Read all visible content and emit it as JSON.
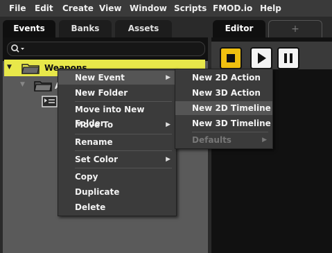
{
  "menubar": {
    "items": [
      "File",
      "Edit",
      "Create",
      "View",
      "Window",
      "Scripts",
      "FMOD.io",
      "Help"
    ]
  },
  "left_tabs": [
    "Events",
    "Banks",
    "Assets"
  ],
  "editor_tabs": {
    "editor": "Editor",
    "add": "+"
  },
  "tree": {
    "selected_folder": "Weapons",
    "child_folder_partial": "A"
  },
  "context_menu": {
    "items": [
      "New Event",
      "New Folder",
      "Move into New Folder",
      "Move To",
      "Rename",
      "Set Color",
      "Copy",
      "Duplicate",
      "Delete"
    ]
  },
  "submenu": {
    "items": [
      "New 2D Action",
      "New 3D Action",
      "New 2D Timeline",
      "New 3D Timeline",
      "Defaults"
    ],
    "highlighted": "New 2D Timeline"
  },
  "colors": {
    "selection": "#e8e84a",
    "stop": "#f0c010"
  },
  "icons": [
    "search-icon",
    "folder-icon",
    "event-icon",
    "stop-icon",
    "play-icon",
    "pause-icon",
    "chevron-right-icon"
  ]
}
